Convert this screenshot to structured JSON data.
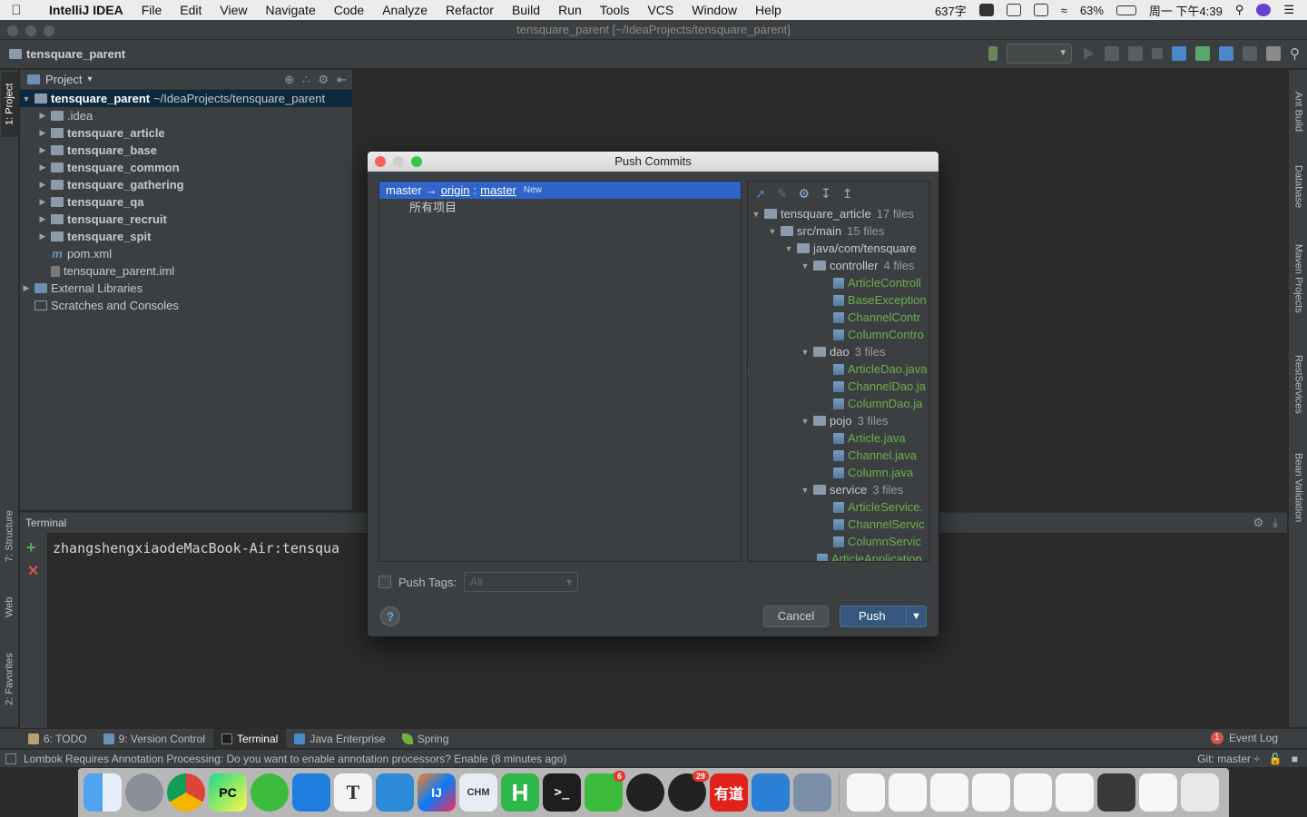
{
  "menubar": {
    "app_name": "IntelliJ IDEA",
    "items": [
      "File",
      "Edit",
      "View",
      "Navigate",
      "Code",
      "Analyze",
      "Refactor",
      "Build",
      "Run",
      "Tools",
      "VCS",
      "Window",
      "Help"
    ],
    "chars_count": "637字",
    "battery": "63%",
    "datetime": "周一 下午4:39"
  },
  "window": {
    "title": "tensquare_parent [~/IdeaProjects/tensquare_parent]",
    "breadcrumb": "tensquare_parent"
  },
  "left_strip": {
    "project": "1: Project",
    "structure": "7: Structure",
    "web": "Web",
    "favorites": "2: Favorites"
  },
  "right_strip": {
    "ant": "Ant Build",
    "database": "Database",
    "maven": "Maven Projects",
    "rest": "RestServices",
    "bean": "Bean Validation"
  },
  "project_panel": {
    "header": "Project",
    "root_name": "tensquare_parent",
    "root_path": "~/IdeaProjects/tensquare_parent",
    "children": [
      ".idea",
      "tensquare_article",
      "tensquare_base",
      "tensquare_common",
      "tensquare_gathering",
      "tensquare_qa",
      "tensquare_recruit",
      "tensquare_spit"
    ],
    "pom": "pom.xml",
    "iml": "tensquare_parent.iml",
    "external": "External Libraries",
    "scratches": "Scratches and Consoles"
  },
  "terminal": {
    "header": "Terminal",
    "prompt": "zhangshengxiaodeMacBook-Air:tensqua"
  },
  "tooltabs": {
    "todo": "6: TODO",
    "vcs": "9: Version Control",
    "terminal": "Terminal",
    "java_enterprise": "Java Enterprise",
    "spring": "Spring",
    "event_log": "Event Log",
    "event_count": "1"
  },
  "statusbar": {
    "message": "Lombok Requires Annotation Processing: Do you want to enable annotation processors? Enable (8 minutes ago)",
    "git": "Git: master ÷"
  },
  "dialog": {
    "title": "Push Commits",
    "branch_local": "master",
    "arrow": "→",
    "remote": "origin",
    "colon": ":",
    "branch_remote": "master",
    "new_tag": "New",
    "all_items": "所有项目",
    "push_tags_label": "Push Tags:",
    "push_tags_value": "All",
    "cancel": "Cancel",
    "push": "Push",
    "help": "?",
    "tree": {
      "module": "tensquare_article",
      "module_count": "17 files",
      "src": "src/main",
      "src_count": "15 files",
      "pkg": "java/com/tensquare",
      "controller": "controller",
      "controller_count": "4 files",
      "controller_files": [
        "ArticleControll",
        "BaseException",
        "ChannelContr",
        "ColumnContro"
      ],
      "dao": "dao",
      "dao_count": "3 files",
      "dao_files": [
        "ArticleDao.java",
        "ChannelDao.ja",
        "ColumnDao.ja"
      ],
      "pojo": "pojo",
      "pojo_count": "3 files",
      "pojo_files": [
        "Article.java",
        "Channel.java",
        "Column.java"
      ],
      "service": "service",
      "service_count": "3 files",
      "service_files": [
        "ArticleService.",
        "ChannelServic",
        "ColumnServic"
      ],
      "last_partial": "ArticleApplication"
    }
  },
  "dock": {
    "chm": "CHM",
    "wechat_badge": "6",
    "qq_badge": "29",
    "youdao": "有道"
  },
  "colors": {
    "accent_select": "#2f65ca",
    "file_added_green": "#6ab04c",
    "push_button": "#365880"
  }
}
